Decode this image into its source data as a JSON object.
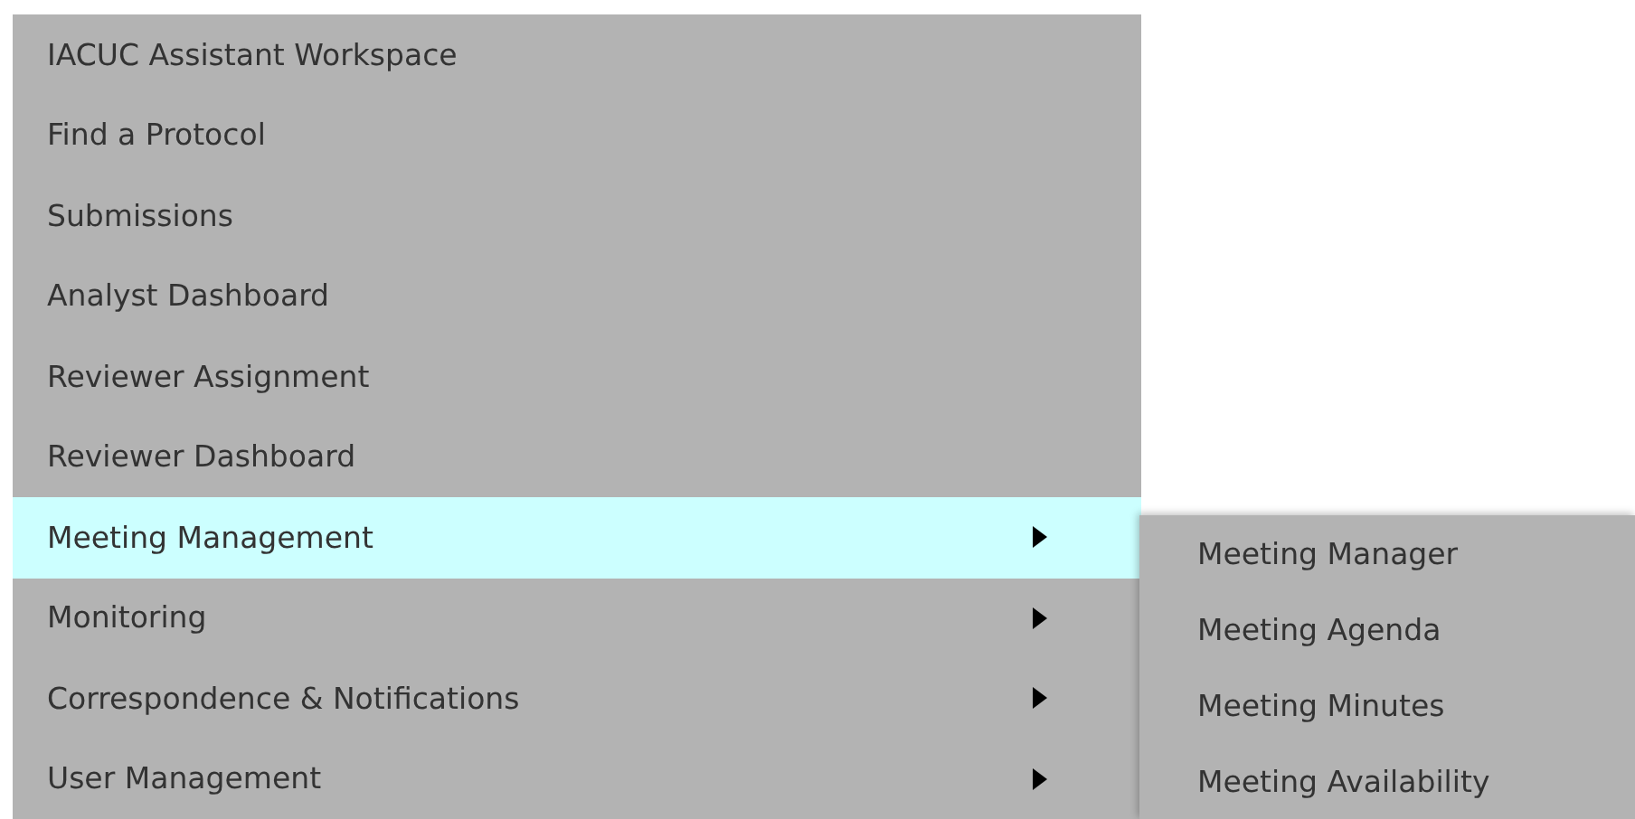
{
  "menu": {
    "items": [
      {
        "label": "IACUC Assistant Workspace",
        "has_submenu": false,
        "selected": false
      },
      {
        "label": "Find a Protocol",
        "has_submenu": false,
        "selected": false
      },
      {
        "label": "Submissions",
        "has_submenu": false,
        "selected": false
      },
      {
        "label": "Analyst Dashboard",
        "has_submenu": false,
        "selected": false
      },
      {
        "label": "Reviewer Assignment",
        "has_submenu": false,
        "selected": false
      },
      {
        "label": "Reviewer Dashboard",
        "has_submenu": false,
        "selected": false
      },
      {
        "label": "Meeting Management",
        "has_submenu": true,
        "selected": true,
        "children": [
          {
            "label": "Meeting Manager"
          },
          {
            "label": "Meeting Agenda"
          },
          {
            "label": "Meeting Minutes"
          },
          {
            "label": "Meeting Availability"
          }
        ]
      },
      {
        "label": "Monitoring",
        "has_submenu": true,
        "selected": false
      },
      {
        "label": "Correspondence & Notifications",
        "has_submenu": true,
        "selected": false
      },
      {
        "label": "User Management",
        "has_submenu": true,
        "selected": false
      }
    ]
  }
}
